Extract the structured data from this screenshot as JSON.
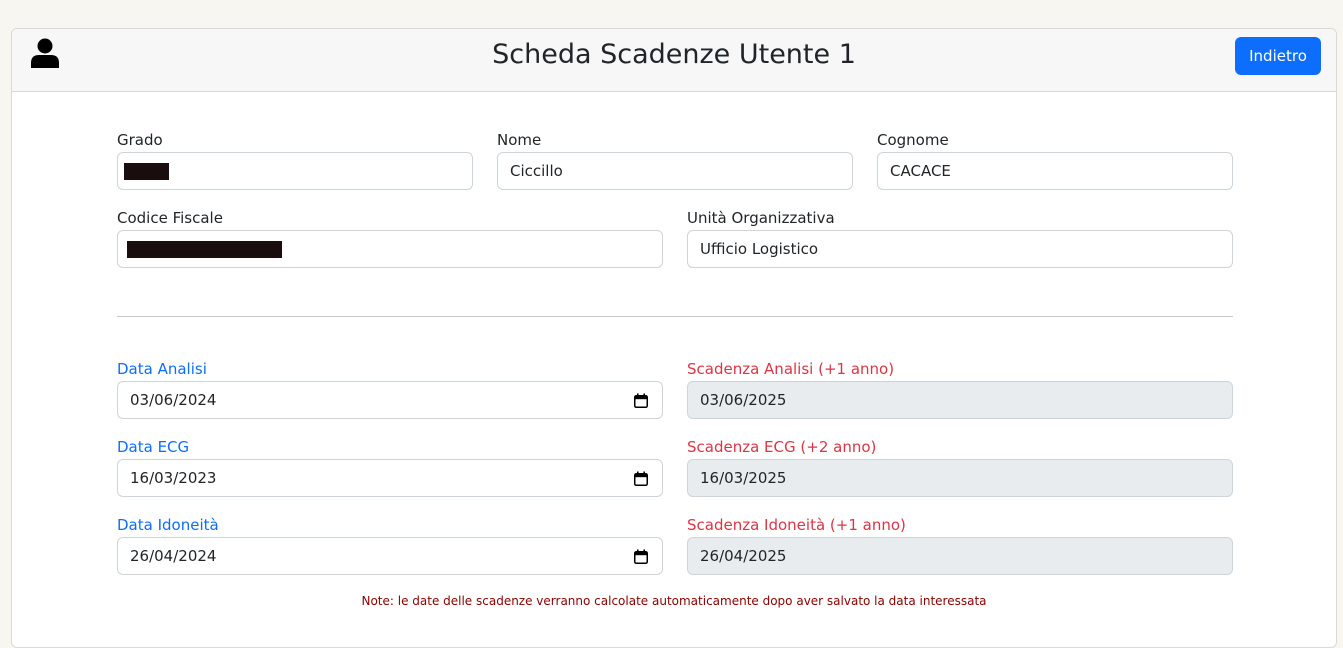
{
  "header": {
    "title": "Scheda Scadenze Utente 1",
    "back_label": "Indietro",
    "user_icon": "user-icon"
  },
  "personal": {
    "grado": {
      "label": "Grado",
      "value": "",
      "redacted": true
    },
    "nome": {
      "label": "Nome",
      "value": "Ciccillo"
    },
    "cognome": {
      "label": "Cognome",
      "value": "CACACE"
    },
    "codice_fiscale": {
      "label": "Codice Fiscale",
      "value": "",
      "redacted": true
    },
    "unita": {
      "label": "Unità Organizzativa",
      "value": "Ufficio Logistico"
    }
  },
  "dates": {
    "analisi": {
      "label": "Data Analisi",
      "value": "03/06/2024"
    },
    "scad_analisi": {
      "label": "Scadenza Analisi (+1 anno)",
      "value": "03/06/2025"
    },
    "ecg": {
      "label": "Data ECG",
      "value": "16/03/2023"
    },
    "scad_ecg": {
      "label": "Scadenza ECG (+2 anno)",
      "value": "16/03/2025"
    },
    "idoneita": {
      "label": "Data Idoneità",
      "value": "26/04/2024"
    },
    "scad_idoneita": {
      "label": "Scadenza Idoneità (+1 anno)",
      "value": "26/04/2025"
    }
  },
  "note": "Note: le date delle scadenze verranno calcolate automaticamente dopo aver salvato la data interessata",
  "colors": {
    "primary": "#0d6efd",
    "danger": "#dc3545",
    "note": "#8b0000",
    "readonly_bg": "#e9ecef"
  }
}
